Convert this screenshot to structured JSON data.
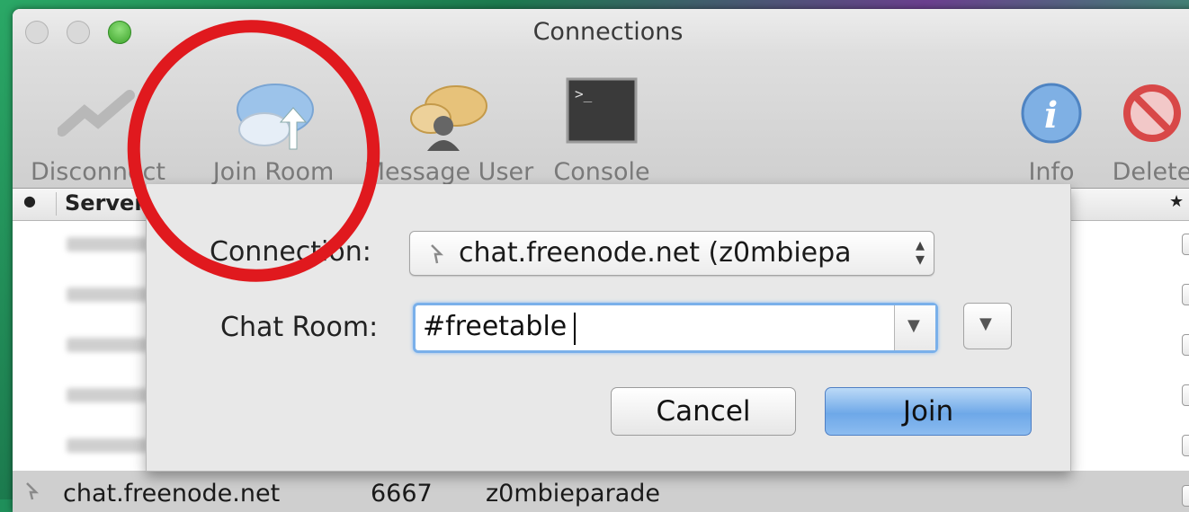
{
  "window": {
    "title": "Connections"
  },
  "toolbar": {
    "disconnect_label": "Disconnect",
    "join_room_label": "Join Room",
    "message_user_label": "Message User",
    "console_label": "Console",
    "info_label": "Info",
    "delete_label": "Delete"
  },
  "table": {
    "status_col": "●",
    "server_col": "Server",
    "favorite_col": "★",
    "selected_row": {
      "server": "chat.freenode.net",
      "port": "6667",
      "nick": "z0mbieparade"
    }
  },
  "dialog": {
    "connection_label": "Connection:",
    "connection_value": "chat.freenode.net (z0mbiepa",
    "chat_room_label": "Chat Room:",
    "chat_room_value": "#freetable",
    "cancel_label": "Cancel",
    "join_label": "Join"
  },
  "colors": {
    "annotation_circle": "#e0191e",
    "join_button": "#6ea8e8"
  }
}
